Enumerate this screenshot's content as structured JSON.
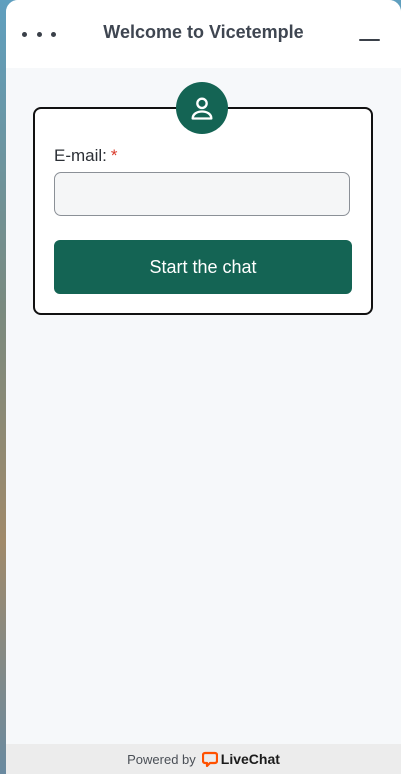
{
  "header": {
    "title": "Welcome to Vicetemple",
    "menu_icon": "more-horizontal-icon",
    "minimize_icon": "minimize-icon"
  },
  "form": {
    "avatar_icon": "user-icon",
    "email_label": "E-mail:",
    "required_mark": "*",
    "email_value": "",
    "start_button_label": "Start the chat"
  },
  "footer": {
    "powered_by": "Powered by",
    "brand": "LiveChat",
    "brand_icon": "livechat-logo-icon"
  },
  "colors": {
    "accent": "#146454",
    "required": "#d93a2b",
    "brand_orange": "#ff5100"
  }
}
